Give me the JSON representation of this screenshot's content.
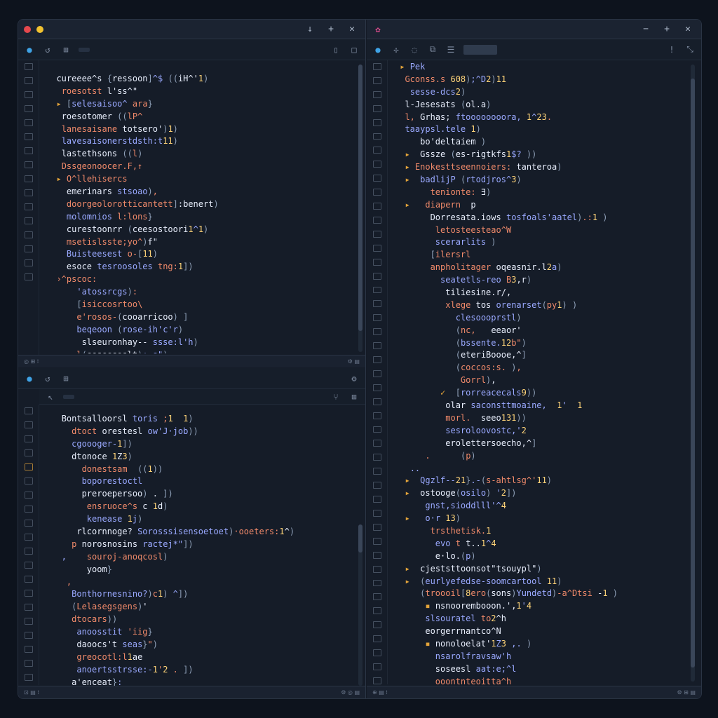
{
  "colors": {
    "accent_orange": "#e3a43a",
    "accent_blue": "#3fa3e6",
    "accent_pink": "#d94c8c",
    "close_dot": "#e5484d",
    "min_dot": "#f2c230"
  },
  "left_window": {
    "title": "",
    "controls": [
      "↓",
      "+",
      "✕"
    ],
    "top_pane": {
      "toolbar_tab": "",
      "lines": [
        "  cureeee^s {ressoon]^$ ((iH^'1)",
        "   roesotst l'ss^\"",
        "  ▸ [selesaisoo^ ara}",
        "   roesotomer ((lP^",
        "   lanesaisane totsero')1)",
        "   lavesaisonerstdsth:t11)",
        "   lastethsons ((l)",
        "   Dssgeonoocer.F,↑",
        "  ▸ O^llehisercs",
        "    emerinars stsoao),",
        "    doorgeolorotticantett]:benert)",
        "    molomnios l:lons}",
        "    curestoonrr (ceesostoori1^1)",
        "    msetislsste;yo^)f\"",
        "    Buisteesest o-[11)",
        "    esoce tesroosoles tng:1])",
        "  ›^pscoc:",
        "      'atossrcgs):",
        "      [isiccosrtoo\\",
        "      e'rosos-(cooarricoo) ]",
        "      beqeoon (rose-ih'c'r)",
        "       slseuronhay-- ssse:l'h)",
        "      l(eeseesoslt)+-s\")"
      ]
    },
    "bottom_pane": {
      "toolbar_tab": "",
      "lines": [
        "   Bontsalloorsl toris ;1  1)",
        "     dtoct orestesl ow'J·job))",
        "     cgoooger-1])",
        "     dtonoce 1Z3)",
        "       donestsam  ((1))",
        "       boporestoctl",
        "       preroepersoo) . ])",
        "        ensruoce^s c 1d)",
        "        kenease 1j)",
        "      rlcornnoge? Sorosssisensoetoet)·ooeters:1^)",
        "     p norosnosins ractej*\"])",
        "   ,    souroj-anoqcosl)",
        "        yoom}",
        "    ,",
        "     Bonthornesnino?)c1) ^])",
        "     (Lelasegsgens)'",
        "     dtocars))",
        "      anoosstit 'iig}",
        "      daoocs't seas}\")",
        "      greocotl:l1ae",
        "      anoertsstrsse:-1'2 . ])",
        "     a'enceat}:"
      ]
    }
  },
  "right_window": {
    "title": "",
    "controls": [
      "−",
      "+",
      "✕"
    ],
    "toolbar_tab": "",
    "lines": [
      " ▸ Pek",
      "  Gconss.s 608);^D2)11",
      "   sesse-dcs2)",
      "  l-Jesesats (ol.a)",
      "  l, Grhas; ftoooooooora, 1^23.",
      "  taaypsl.tele 1)",
      "     bo'deltaiem )",
      "  ▸  Gssze (es-rigtkfs1$? ))",
      "  ▸ Enokesttseennoiers: tanteroa)",
      "  ▸  badlijP (rtodjros^3)",
      "       tenionte: ∃)",
      "  ▸   diapern  p",
      "       Dorresata.iows tosfoals'aatel).:1 )",
      "        letosteesteao^W",
      "        scerarlits )",
      "       [ilersrl",
      "       anpholitager oqeasnir.l2a)",
      "         seatetls-reo B3,r)",
      "          tiliesine.r/,",
      "          xlege tos orenarset(py1) )",
      "            clesoooprstl)",
      "            (nc,   eeaor'",
      "            (bssente.12b\")",
      "            (eteriBoooe,^]",
      "            (coccos:s. ),",
      "             Gorrl),",
      "         ✓  [rorreacecals9))",
      "          olar saconsttmoaine,  1'  1",
      "          morl.  seeo131))",
      "          sesroloovostc,'2",
      "          erolettersoecho,^]",
      "      .      (p)",
      "   ..",
      "  ▸  Qgzlf--21}.-(s-ahtlsg^'11)",
      "  ▸  ostooge(osilo) '2])",
      "      gnst,sioddlll'^4",
      "  ▸   o·r 13)",
      "       trsthetisk.1",
      "        evo t t..1^4",
      "        e·lo.(p)",
      "  ▸  cjeststtoonsot\"tsouypl\")",
      "  ▸  (eurlyefedse-soomcartool 11)",
      "     (troooil[8ero(sons)Yundetd)-a^Dtsi -1 )",
      "      ▪ nsnoorembooon.',1'4",
      "      slsouratel to2^h",
      "      eorgerrnantco^N",
      "      ▪ nonoloelat'1Z3 ,. )",
      "        nsarolfravsaw'h",
      "        soseesl aat:e;^l",
      "        ooontnteoitta^h"
    ]
  }
}
